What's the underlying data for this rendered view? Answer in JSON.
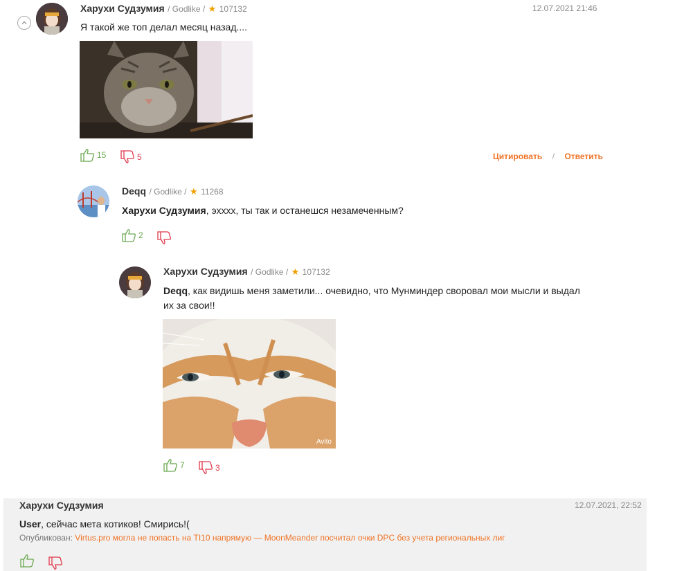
{
  "comments": [
    {
      "author": "Харухи Судзумия",
      "rank": "/ Godlike /",
      "rating": "107132",
      "date": "12.07.2021 21:46",
      "text": "Я такой же топ делал месяц назад....",
      "likes": "15",
      "dislikes": "5",
      "quote_label": "Цитировать",
      "separator": "/",
      "reply_label": "Ответить"
    },
    {
      "author": "Deqq",
      "rank": "/ Godlike /",
      "rating": "11268",
      "mention": "Харухи Судзумия",
      "text": ", эхххх, ты так и останешся незамеченным?",
      "likes": "2",
      "dislikes": ""
    },
    {
      "author": "Харухи Судзумия",
      "rank": "/ Godlike /",
      "rating": "107132",
      "mention": "Deqq",
      "text_line1": ", как видишь меня заметили... очевидно, что Мунминдер своровал мои мысли и выдал",
      "text_line2": "их за свои!!",
      "image_watermark": "Avito",
      "likes": "7",
      "dislikes": "3"
    },
    {
      "author": "Харухи Судзумия",
      "date": "12.07.2021, 22:52",
      "mention": "User",
      "text": ", сейчас мета котиков! Смирись!(",
      "published_label": "Опубликован:",
      "published_link": "Virtus.pro могла не попасть на TI10 напрямую — MoonMeander посчитал очки DPC без учета региональных лиг",
      "likes": "",
      "dislikes": ""
    }
  ],
  "colors": {
    "accent": "#f07326",
    "like": "#6aa84f",
    "dislike": "#e0384b",
    "star": "#f0a000"
  },
  "icons": [
    "chevron-up-icon",
    "star-icon",
    "thumb-up-icon",
    "thumb-down-icon"
  ]
}
